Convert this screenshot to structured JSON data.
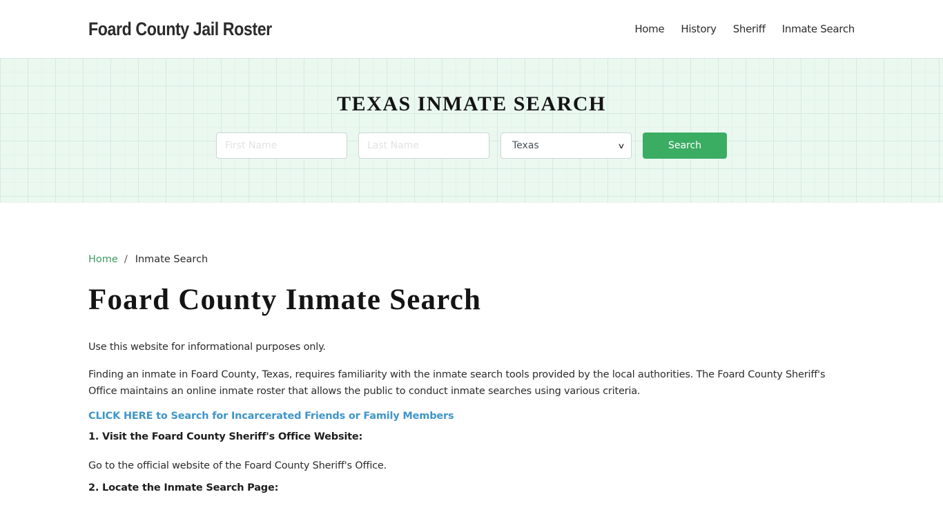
{
  "header": {
    "brand": "Foard County Jail Roster",
    "nav": [
      {
        "label": "Home"
      },
      {
        "label": "History"
      },
      {
        "label": "Sheriff"
      },
      {
        "label": "Inmate Search"
      }
    ]
  },
  "hero": {
    "title": "TEXAS INMATE SEARCH",
    "first_name_placeholder": "First Name",
    "last_name_placeholder": "Last Name",
    "state_selected": "Texas",
    "search_label": "Search"
  },
  "breadcrumb": {
    "home": "Home",
    "separator": "/",
    "current": "Inmate Search"
  },
  "main": {
    "title": "Foard County Inmate Search",
    "intro": "Use this website for informational purposes only.",
    "paragraph": "Finding an inmate in Foard County, Texas, requires familiarity with the inmate search tools provided by the local authorities. The Foard County Sheriff's Office maintains an online inmate roster that allows the public to conduct inmate searches using various criteria.",
    "cta_link": "CLICK HERE to Search for Incarcerated Friends or Family Members",
    "steps": [
      {
        "heading": "1. Visit the Foard County Sheriff's Office Website:",
        "text": "Go to the official website of the Foard County Sheriff's Office."
      },
      {
        "heading": "2. Locate the Inmate Search Page:"
      }
    ]
  },
  "colors": {
    "accent_green": "#3bad63",
    "link_blue": "#3f95c9",
    "hero_bg": "#eaf8f0"
  }
}
